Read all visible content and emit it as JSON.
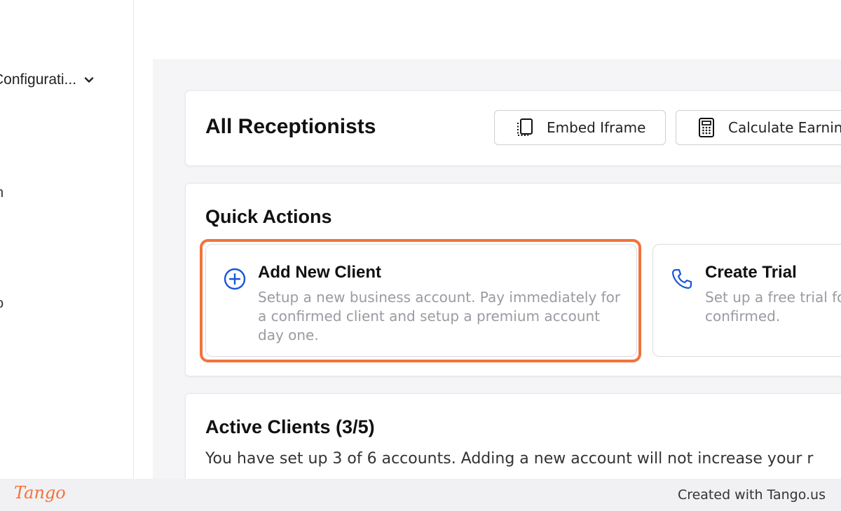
{
  "sidebar": {
    "menu_label": "Configurati...",
    "frag_1": "n",
    "frag_2": "o"
  },
  "header": {
    "title": "All Receptionists",
    "embed_label": "Embed Iframe",
    "calc_label": "Calculate Earnings"
  },
  "quick_actions": {
    "title": "Quick Actions",
    "add_client": {
      "title": "Add New Client",
      "description": "Setup a new business account. Pay immediately for a confirmed client and setup a premium account day one."
    },
    "create_trial": {
      "title": "Create Trial",
      "description": "Set up a free trial for they are confirmed."
    }
  },
  "active_clients": {
    "title": "Active Clients (3/5)",
    "description": "You have set up 3 of 6 accounts. Adding a new account will not increase your r"
  },
  "footer": {
    "logo_text": "Tango",
    "created_with": "Created with Tango.us"
  },
  "colors": {
    "accent": "#f2733b",
    "icon_blue": "#1a56db",
    "muted_text": "#9a9aa3"
  }
}
